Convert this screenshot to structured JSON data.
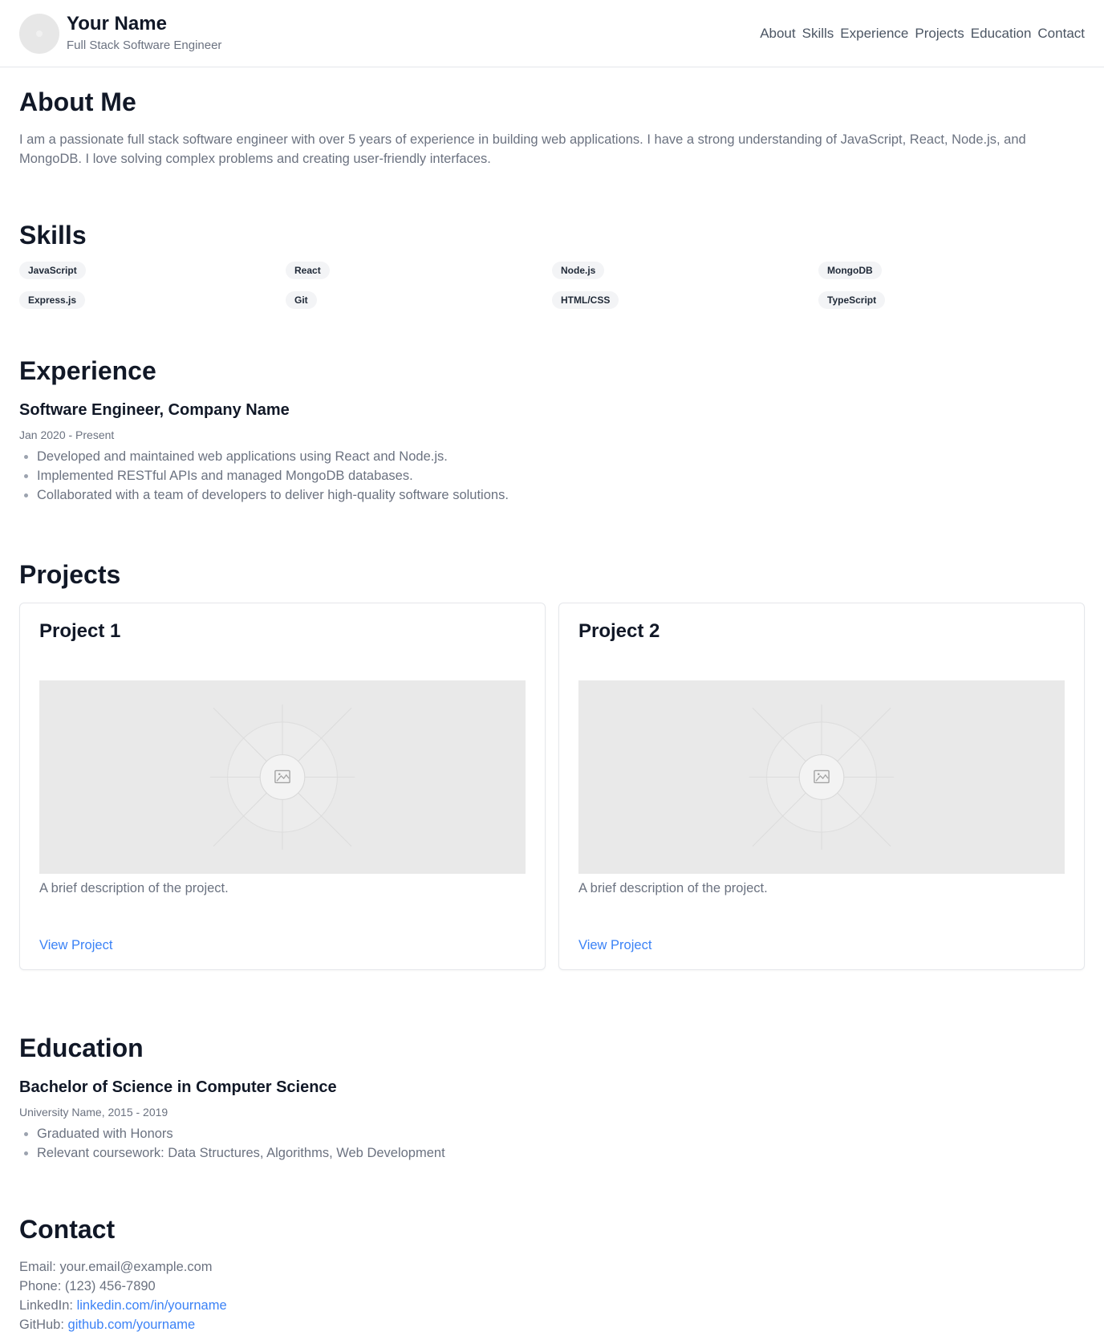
{
  "header": {
    "name": "Your Name",
    "title": "Full Stack Software Engineer",
    "nav": [
      "About",
      "Skills",
      "Experience",
      "Projects",
      "Education",
      "Contact"
    ]
  },
  "about": {
    "heading": "About Me",
    "text": "I am a passionate full stack software engineer with over 5 years of experience in building web applications. I have a strong understanding of JavaScript, React, Node.js, and MongoDB. I love solving complex problems and creating user-friendly interfaces."
  },
  "skills": {
    "heading": "Skills",
    "items": [
      "JavaScript",
      "React",
      "Node.js",
      "MongoDB",
      "Express.js",
      "Git",
      "HTML/CSS",
      "TypeScript"
    ]
  },
  "experience": {
    "heading": "Experience",
    "job_title": "Software Engineer, Company Name",
    "dates": "Jan 2020 - Present",
    "bullets": [
      "Developed and maintained web applications using React and Node.js.",
      "Implemented RESTful APIs and managed MongoDB databases.",
      "Collaborated with a team of developers to deliver high-quality software solutions."
    ]
  },
  "projects": {
    "heading": "Projects",
    "items": [
      {
        "title": "Project 1",
        "description": "A brief description of the project.",
        "link_label": "View Project"
      },
      {
        "title": "Project 2",
        "description": "A brief description of the project.",
        "link_label": "View Project"
      }
    ]
  },
  "education": {
    "heading": "Education",
    "degree": "Bachelor of Science in Computer Science",
    "meta": "University Name, 2015 - 2019",
    "bullets": [
      "Graduated with Honors",
      "Relevant coursework: Data Structures, Algorithms, Web Development"
    ]
  },
  "contact": {
    "heading": "Contact",
    "email_label": "Email:",
    "email": "your.email@example.com",
    "phone_label": "Phone:",
    "phone": "(123) 456-7890",
    "linkedin_label": "LinkedIn:",
    "linkedin": "linkedin.com/in/yourname",
    "github_label": "GitHub:",
    "github": "github.com/yourname"
  },
  "colors": {
    "link": "#3b82f6",
    "muted_text": "#6b7280",
    "heading_text": "#111827",
    "skill_bg": "#f3f4f6",
    "placeholder_bg": "#e9e9e9"
  },
  "icons": {
    "placeholder_image": "image-icon"
  }
}
